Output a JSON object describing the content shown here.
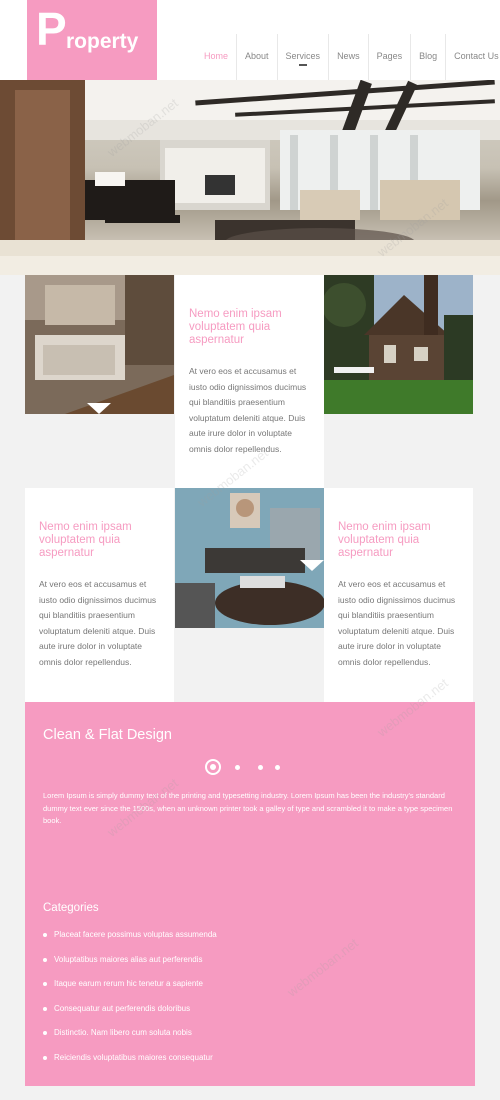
{
  "header": {
    "logo_first": "P",
    "logo_rest": "roperty",
    "nav": [
      {
        "label": "Home",
        "active": true
      },
      {
        "label": "About"
      },
      {
        "label": "Services",
        "marker": true
      },
      {
        "label": "News"
      },
      {
        "label": "Pages"
      },
      {
        "label": "Blog"
      },
      {
        "label": "Contact Us"
      }
    ]
  },
  "grid": {
    "heading": "Nemo enim ipsam voluptatem quia aspernatur",
    "body": "At vero eos et accusamus et iusto odio dignissimos ducimus qui blanditiis praesentium voluptatum deleniti atque. Duis aute irure dolor in voluptate omnis dolor repellendus."
  },
  "feature": {
    "title": "Clean & Flat Design",
    "paragraph": "Lorem Ipsum is simply dummy text of the printing and typesetting industry. Lorem Ipsum has been the industry's standard dummy text ever since the 1500s, when an unknown printer took a galley of type and scrambled it to make a type specimen book."
  },
  "categories": {
    "title": "Categories",
    "items": [
      "Placeat facere possimus voluptas assumenda",
      "Voluptatibus maiores alias aut perferendis",
      "Itaque earum rerum hic tenetur a sapiente",
      "Consequatur aut perferendis doloribus",
      "Distinctio. Nam libero cum soluta nobis",
      "Reiciendis voluptatibus maiores consequatur"
    ]
  },
  "watermark": "webmoban.net",
  "colors": {
    "accent": "#f69bc1",
    "background": "#f2f2f2"
  }
}
